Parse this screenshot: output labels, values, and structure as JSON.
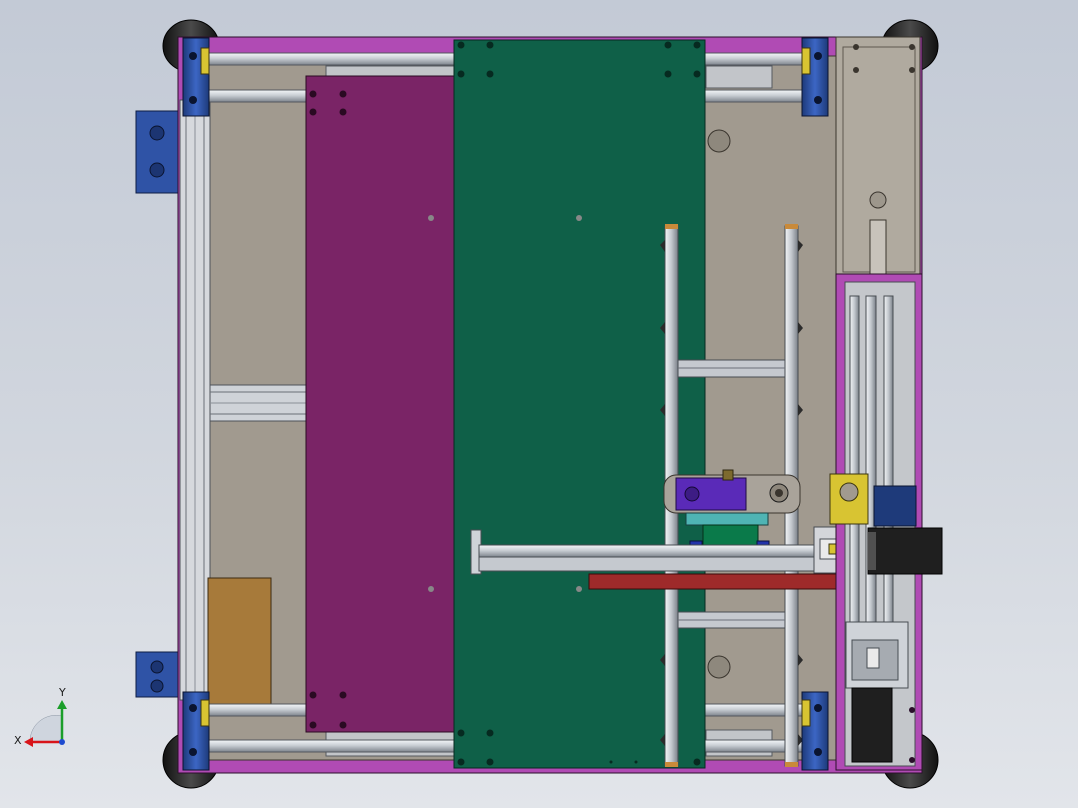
{
  "triad": {
    "x_label": "X",
    "y_label": "Y",
    "x_color": "#d8141a",
    "y_color": "#1b9e2a",
    "z_color": "#1e4bd0"
  },
  "colors": {
    "frame_purple": "#b04bb4",
    "panel_gray": "#a19a8f",
    "plate_magenta": "#7a2466",
    "plate_green": "#0f6048",
    "motor_black": "#1f1f1f",
    "rail_red": "#9e2a2a",
    "bracket_yellow": "#d8c432",
    "mount_blue": "#2d4f9c",
    "block_tan": "#a77a3a"
  }
}
